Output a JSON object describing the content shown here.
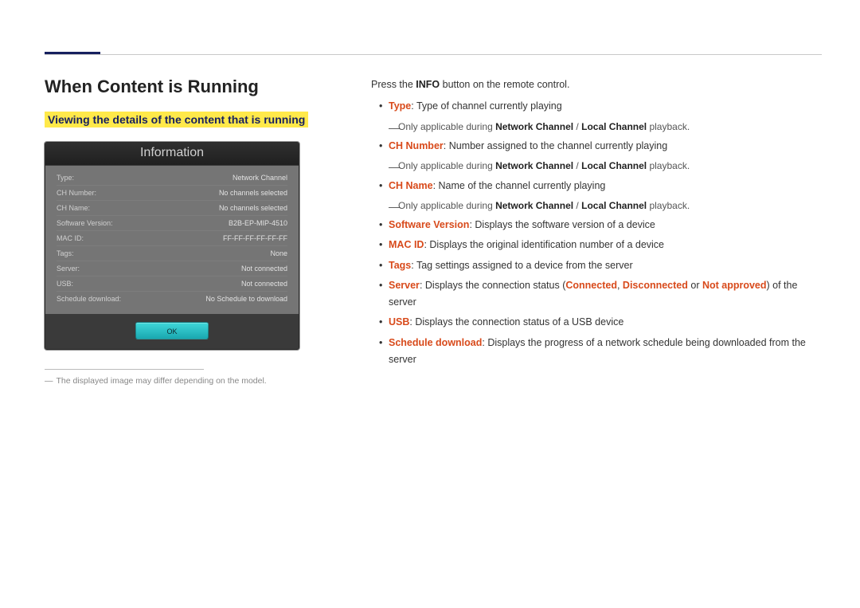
{
  "header": {
    "title": "When Content is Running",
    "subtitle": "Viewing the details of the content that is running"
  },
  "info_panel": {
    "title": "Information",
    "rows": [
      {
        "label": "Type:",
        "value": "Network Channel"
      },
      {
        "label": "CH Number:",
        "value": "No channels selected"
      },
      {
        "label": "CH Name:",
        "value": "No channels selected"
      },
      {
        "label": "Software Version:",
        "value": "B2B-EP-MIP-4510"
      },
      {
        "label": "MAC ID:",
        "value": "FF-FF-FF-FF-FF-FF"
      },
      {
        "label": "Tags:",
        "value": "None"
      },
      {
        "label": "Server:",
        "value": "Not connected"
      },
      {
        "label": "USB:",
        "value": "Not connected"
      },
      {
        "label": "Schedule download:",
        "value": "No Schedule to download"
      }
    ],
    "ok_label": "OK"
  },
  "footnote": "The displayed image may differ depending on the model.",
  "right": {
    "intro_pre": "Press the ",
    "intro_bold": "INFO",
    "intro_post": " button on the remote control.",
    "items": [
      {
        "term": "Type",
        "desc": ": Type of channel currently playing",
        "sub_pre": "Only applicable during ",
        "sub_b1": "Network Channel",
        "sub_sep": " / ",
        "sub_b2": "Local Channel",
        "sub_post": " playback."
      },
      {
        "term": "CH Number",
        "desc": ": Number assigned to the channel currently playing",
        "sub_pre": "Only applicable during ",
        "sub_b1": "Network Channel",
        "sub_sep": " / ",
        "sub_b2": "Local Channel",
        "sub_post": " playback."
      },
      {
        "term": "CH Name",
        "desc": ": Name of the channel currently playing",
        "sub_pre": "Only applicable during ",
        "sub_b1": "Network Channel",
        "sub_sep": " / ",
        "sub_b2": "Local Channel",
        "sub_post": " playback."
      },
      {
        "term": "Software Version",
        "desc": ": Displays the software version of a device"
      },
      {
        "term": "MAC ID",
        "desc": ": Displays the original identification number of a device"
      },
      {
        "term": "Tags",
        "desc": ": Tag settings assigned to a device from the server"
      },
      {
        "term": "Server",
        "desc_pre": ": Displays the connection status (",
        "s1": "Connected",
        "c1": ", ",
        "s2": "Disconnected",
        "c2": " or ",
        "s3": "Not approved",
        "desc_post": ") of the server"
      },
      {
        "term": "USB",
        "desc": ": Displays the connection status of a USB device"
      },
      {
        "term": "Schedule download",
        "desc": ": Displays the progress of a network schedule being downloaded from the server"
      }
    ]
  }
}
